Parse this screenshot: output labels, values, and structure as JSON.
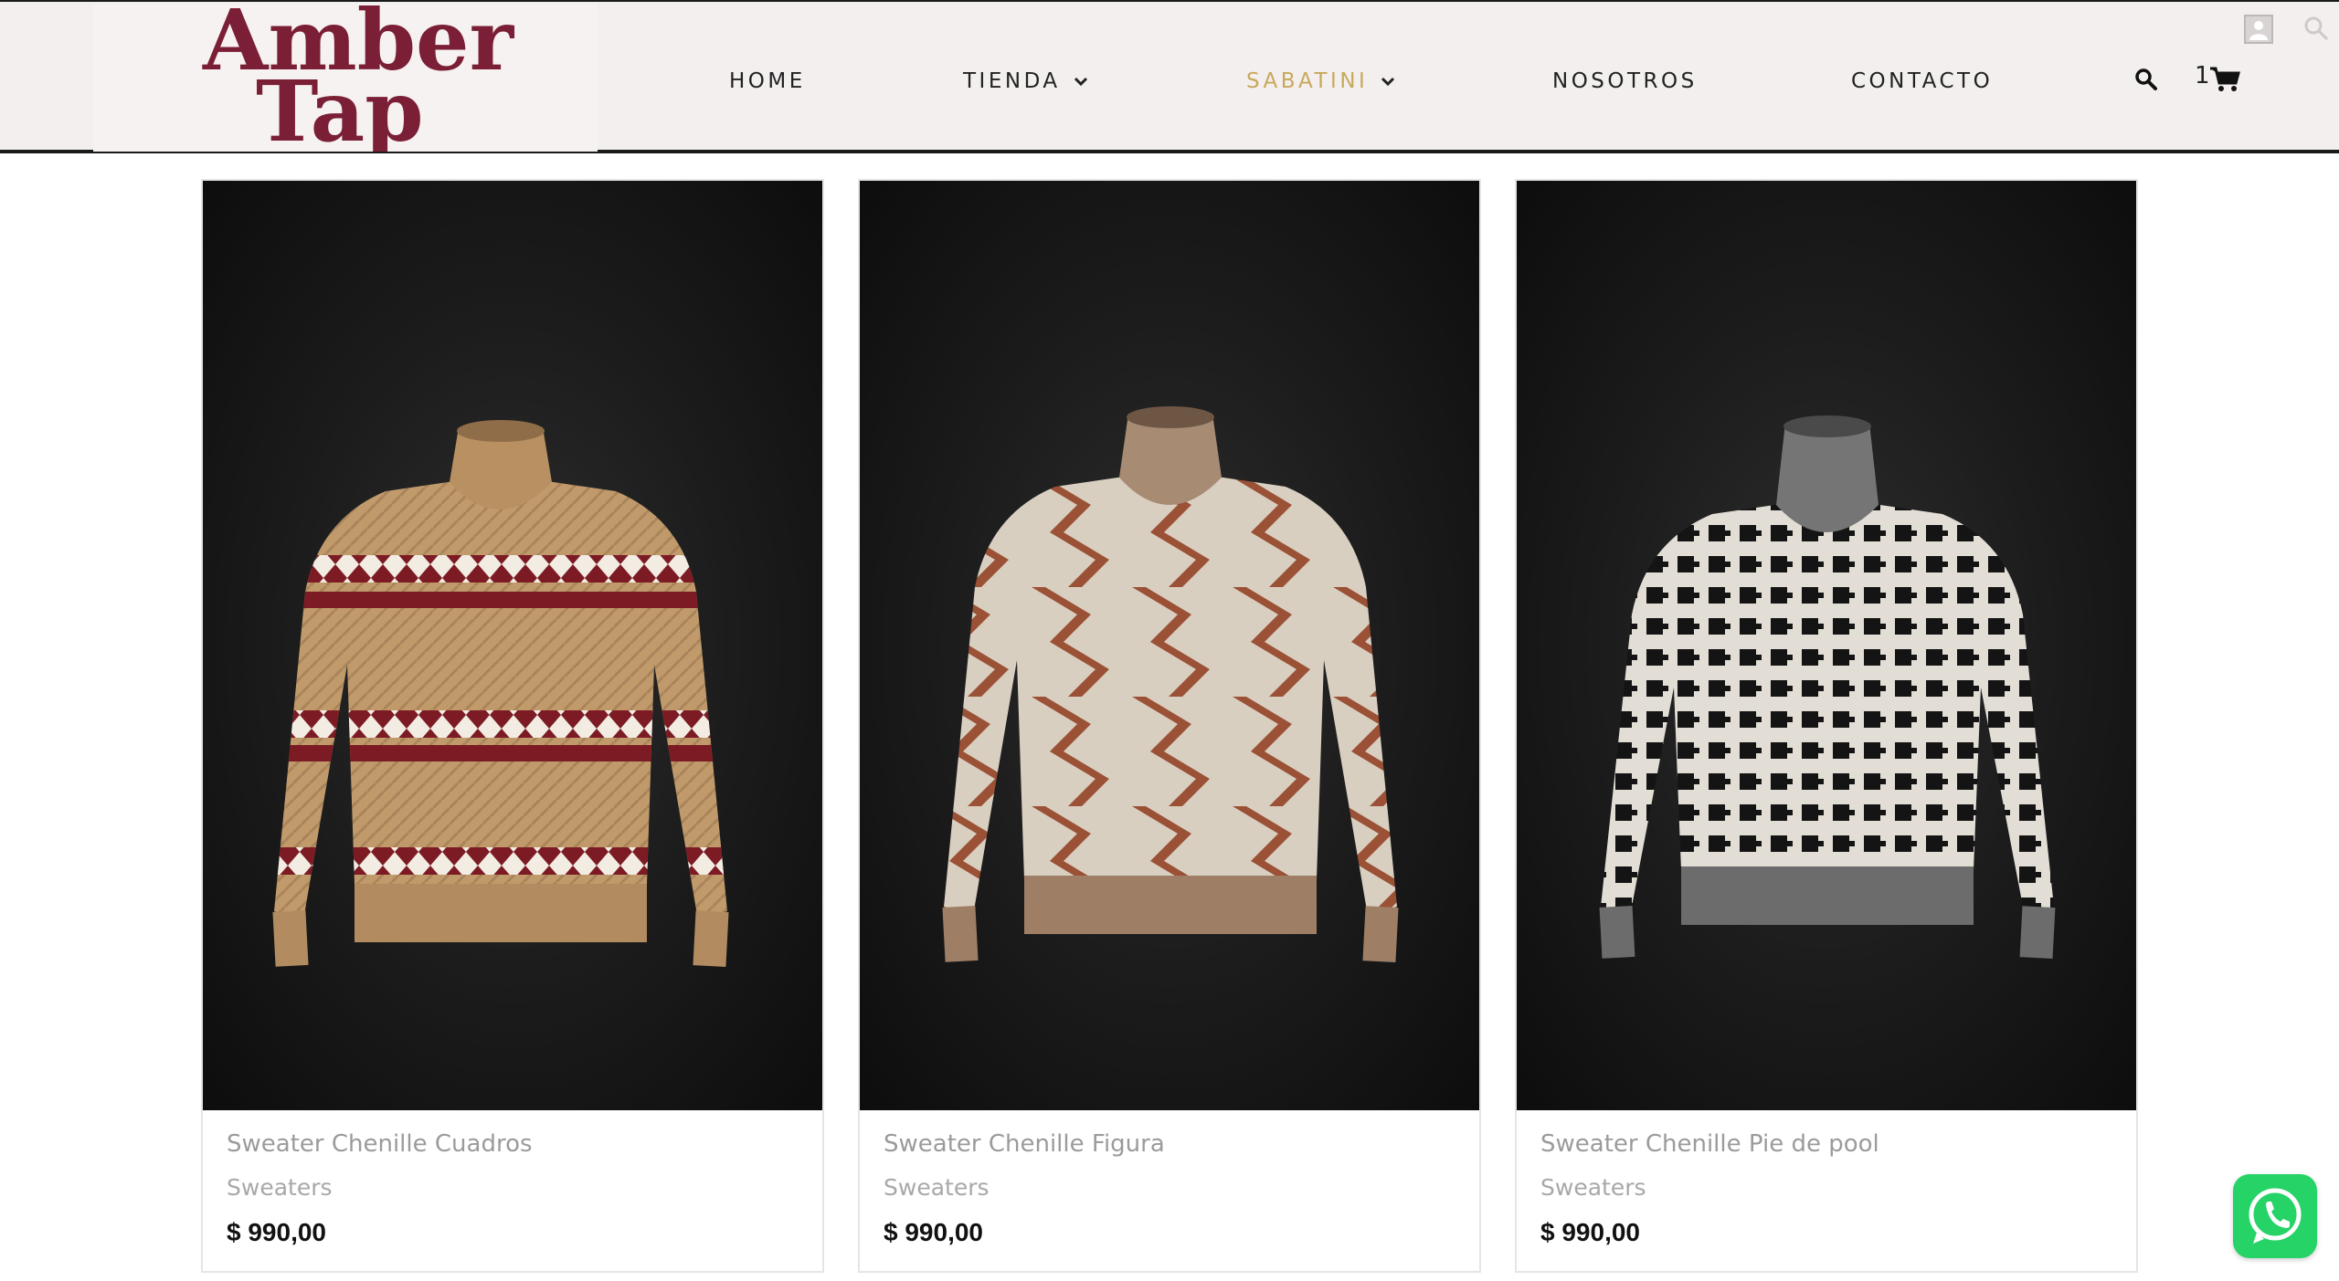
{
  "brand": {
    "logo_line1": "Amber",
    "logo_line2": "Tap",
    "logo_color": "#7a1f36"
  },
  "nav": {
    "items": [
      {
        "label": "HOME",
        "dropdown": false,
        "active": false
      },
      {
        "label": "TIENDA",
        "dropdown": true,
        "active": false
      },
      {
        "label": "SABATINI",
        "dropdown": true,
        "active": true
      },
      {
        "label": "NOSOTROS",
        "dropdown": false,
        "active": false
      },
      {
        "label": "CONTACTO",
        "dropdown": false,
        "active": false
      }
    ],
    "active_color": "#c8a85a",
    "cart_count": "1",
    "icons": [
      "search-icon",
      "cart-icon",
      "user-icon"
    ]
  },
  "products": [
    {
      "title": "Sweater Chenille Cuadros",
      "category": "Sweaters",
      "price": "$ 990,00",
      "image": "tan sweater with burgundy and white diamond stripes"
    },
    {
      "title": "Sweater Chenille Figura",
      "category": "Sweaters",
      "price": "$ 990,00",
      "image": "cream sweater with rust zigzag pattern"
    },
    {
      "title": "Sweater Chenille Pie de pool",
      "category": "Sweaters",
      "price": "$ 990,00",
      "image": "black and white houndstooth check sweater"
    }
  ],
  "whatsapp": {
    "icon": "whatsapp-icon",
    "color": "#25d366"
  }
}
